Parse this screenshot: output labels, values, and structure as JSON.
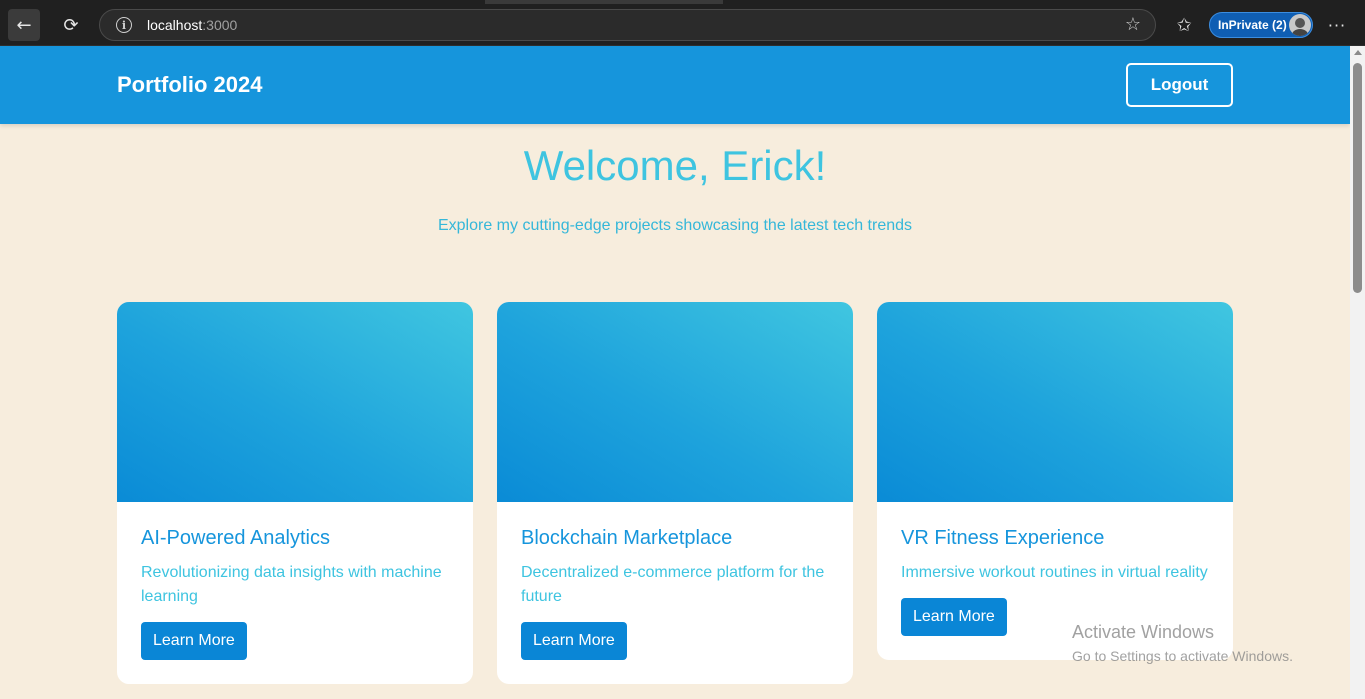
{
  "browser": {
    "url_host": "localhost",
    "url_port": ":3000",
    "inprivate_label": "InPrivate (2)",
    "back_icon": "arrow-left-icon",
    "reload_icon": "reload-icon",
    "favorite_icon": "star-icon",
    "more_icon": "more-icon"
  },
  "navbar": {
    "brand": "Portfolio 2024",
    "logout_label": "Logout",
    "bg_color": "#1695dc"
  },
  "hero": {
    "title": "Welcome, Erick!",
    "subtitle": "Explore my cutting-edge projects showcasing the latest tech trends"
  },
  "projects": [
    {
      "title": "AI-Powered Analytics",
      "description": "Revolutionizing data insights with machine learning",
      "button_label": "Learn More"
    },
    {
      "title": "Blockchain Marketplace",
      "description": "Decentralized e-commerce platform for the future",
      "button_label": "Learn More"
    },
    {
      "title": "VR Fitness Experience",
      "description": "Immersive workout routines in virtual reality",
      "button_label": "Learn More"
    }
  ],
  "watermark": {
    "line1": "Activate Windows",
    "line2": "Go to Settings to activate Windows."
  },
  "colors": {
    "page_bg": "#f7eddd",
    "accent": "#1695dc",
    "text_light": "#3ec4e0",
    "button": "#0a86d6"
  }
}
